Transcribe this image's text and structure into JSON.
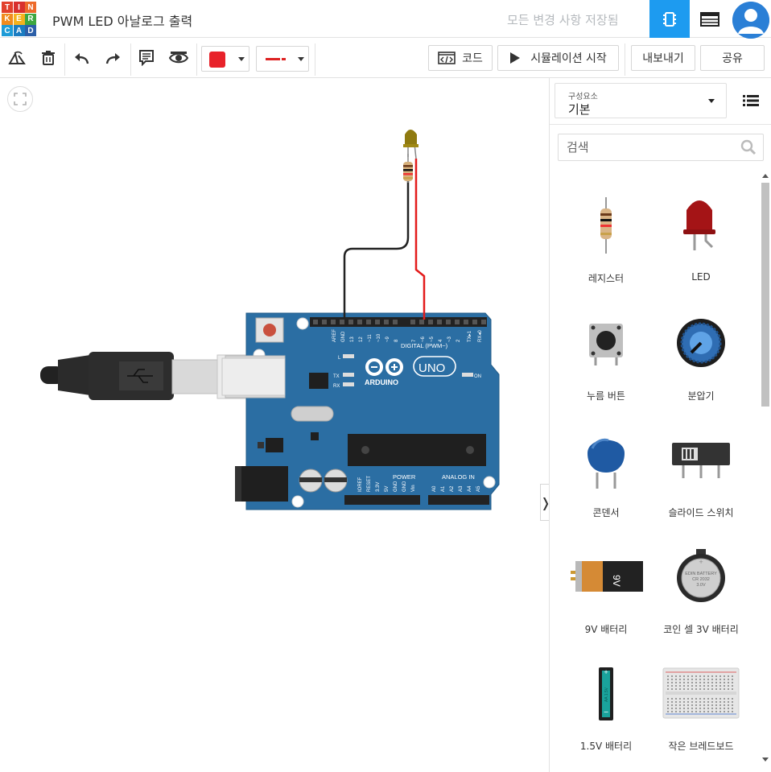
{
  "app": {
    "logo_letters": [
      "T",
      "I",
      "N",
      "K",
      "E",
      "R",
      "C",
      "A",
      "D"
    ],
    "logo_colors": [
      "#e2412c",
      "#d8302e",
      "#ed6a2a",
      "#f08b1e",
      "#f5b21e",
      "#3da740",
      "#1d9bd7",
      "#1a7cc1",
      "#2c5fa8"
    ],
    "title": "PWM LED 아날로그 출력",
    "save_status": "모든 변경 사항 저장됨",
    "accent": "#1d9bf0"
  },
  "toolbar": {
    "color": "#e8222a",
    "code_label": "코드",
    "sim_label": "시뮬레이션 시작",
    "export_label": "내보내기",
    "share_label": "공유"
  },
  "panel": {
    "category_label": "구성요소",
    "category_value": "기본",
    "search_placeholder": "검색",
    "components": [
      {
        "name": "레지스터",
        "icon": "resistor"
      },
      {
        "name": "LED",
        "icon": "led"
      },
      {
        "name": "누름 버튼",
        "icon": "pushbutton"
      },
      {
        "name": "분압기",
        "icon": "potentiometer"
      },
      {
        "name": "콘덴서",
        "icon": "capacitor"
      },
      {
        "name": "슬라이드 스위치",
        "icon": "slide-switch"
      },
      {
        "name": "9V 배터리",
        "icon": "battery-9v"
      },
      {
        "name": "코인 셀 3V 배터리",
        "icon": "coin-cell"
      },
      {
        "name": "1.5V 배터리",
        "icon": "battery-aa"
      },
      {
        "name": "작은 브레드보드",
        "icon": "breadboard"
      }
    ],
    "battery_9v_text": "9V",
    "coin_cell_text": [
      "EDIN BATTERY",
      "CR 2032",
      "3.0V"
    ],
    "aa_text": "AA 1.5V"
  },
  "board": {
    "logo_text": "ARDUINO",
    "model": "UNO",
    "digital_label": "DIGITAL (PWM~)",
    "power_label": "POWER",
    "analog_label": "ANALOG IN",
    "on_label": "ON",
    "led_labels": [
      "L",
      "TX",
      "RX"
    ],
    "top_pins": [
      "AREF",
      "GND",
      "13",
      "12",
      "~11",
      "~10",
      "~9",
      "8",
      "7",
      "~6",
      "~5",
      "4",
      "~3",
      "2",
      "TX▸1",
      "RX◂0"
    ],
    "power_pins": [
      "IOREF",
      "RESET",
      "3.3V",
      "5V",
      "GND",
      "GND",
      "Vin"
    ],
    "analog_pins": [
      "A0",
      "A1",
      "A2",
      "A3",
      "A4",
      "A5"
    ]
  }
}
